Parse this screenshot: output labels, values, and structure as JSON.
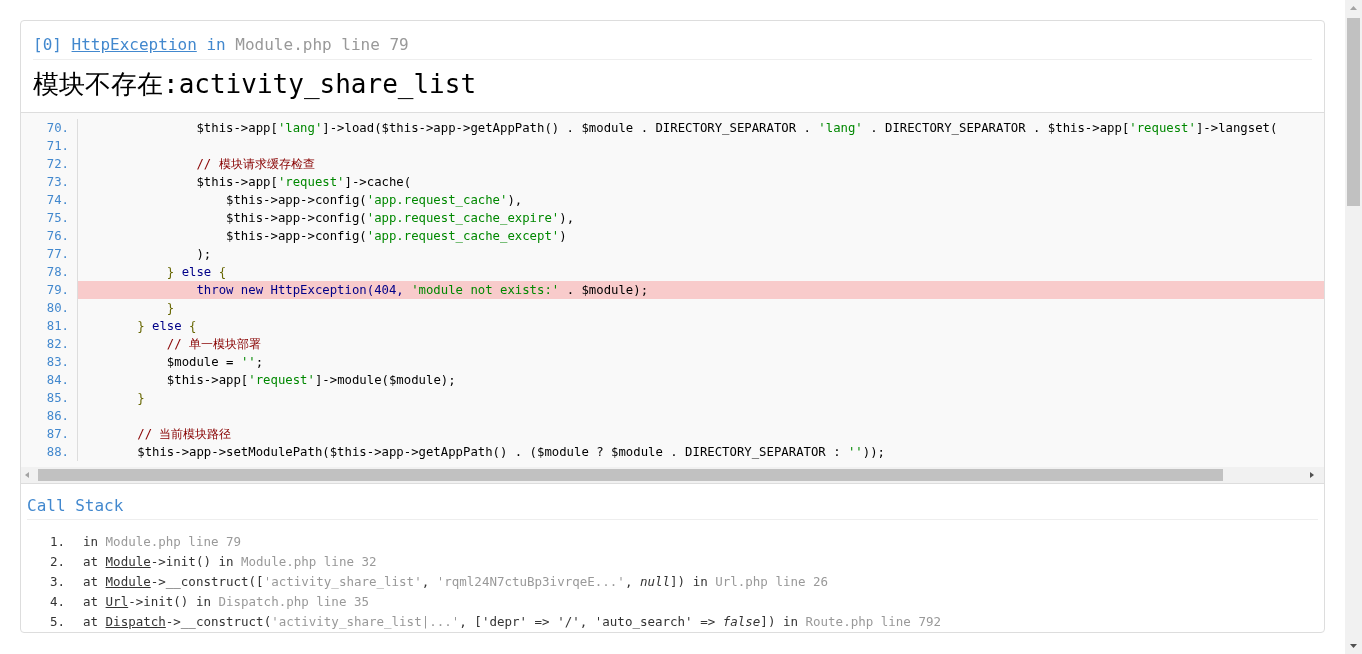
{
  "exception": {
    "index": "[0]",
    "class": "HttpException",
    "in": "in",
    "file": "Module.php line 79"
  },
  "message": "模块不存在:activity_share_list",
  "source": {
    "lines": [
      {
        "number": "70.",
        "highlighted": false,
        "tokens": [
          {
            "kind": "plain",
            "text": "                $this->app["
          },
          {
            "kind": "string",
            "text": "'lang'"
          },
          {
            "kind": "plain",
            "text": "]->load($this->app->getAppPath() . $module . DIRECTORY_SEPARATOR . "
          },
          {
            "kind": "string",
            "text": "'lang'"
          },
          {
            "kind": "plain",
            "text": " . DIRECTORY_SEPARATOR . $this->app["
          },
          {
            "kind": "string",
            "text": "'request'"
          },
          {
            "kind": "plain",
            "text": "]->langset("
          }
        ]
      },
      {
        "number": "71.",
        "highlighted": false
      },
      {
        "number": "72.",
        "highlighted": false,
        "tokens": [
          {
            "kind": "comment",
            "text": "                // 模块请求缓存检查"
          }
        ]
      },
      {
        "number": "73.",
        "highlighted": false,
        "tokens": [
          {
            "kind": "plain",
            "text": "                $this->app["
          },
          {
            "kind": "string",
            "text": "'request'"
          },
          {
            "kind": "plain",
            "text": "]->cache("
          }
        ]
      },
      {
        "number": "74.",
        "highlighted": false,
        "tokens": [
          {
            "kind": "plain",
            "text": "                    $this->app->config("
          },
          {
            "kind": "string",
            "text": "'app.request_cache'"
          },
          {
            "kind": "plain",
            "text": "),"
          }
        ]
      },
      {
        "number": "75.",
        "highlighted": false,
        "tokens": [
          {
            "kind": "plain",
            "text": "                    $this->app->config("
          },
          {
            "kind": "string",
            "text": "'app.request_cache_expire'"
          },
          {
            "kind": "plain",
            "text": "),"
          }
        ]
      },
      {
        "number": "76.",
        "highlighted": false,
        "tokens": [
          {
            "kind": "plain",
            "text": "                    $this->app->config("
          },
          {
            "kind": "string",
            "text": "'app.request_cache_except'"
          },
          {
            "kind": "plain",
            "text": ")"
          }
        ]
      },
      {
        "number": "77.",
        "highlighted": false,
        "tokens": [
          {
            "kind": "plain",
            "text": "                );"
          }
        ]
      },
      {
        "number": "78.",
        "highlighted": false,
        "tokens": [
          {
            "kind": "punct",
            "text": "            }"
          },
          {
            "kind": "keyword",
            "text": " else "
          },
          {
            "kind": "punct",
            "text": "{"
          }
        ]
      },
      {
        "number": "79.",
        "highlighted": true,
        "tokens": [
          {
            "kind": "keyword",
            "text": "                throw new HttpException(404, "
          },
          {
            "kind": "string",
            "text": "'module not exists:'"
          },
          {
            "kind": "plain",
            "text": " . $module);"
          }
        ]
      },
      {
        "number": "80.",
        "highlighted": false,
        "tokens": [
          {
            "kind": "punct",
            "text": "            }"
          }
        ]
      },
      {
        "number": "81.",
        "highlighted": false,
        "tokens": [
          {
            "kind": "punct",
            "text": "        }"
          },
          {
            "kind": "keyword",
            "text": " else "
          },
          {
            "kind": "punct",
            "text": "{"
          }
        ]
      },
      {
        "number": "82.",
        "highlighted": false,
        "tokens": [
          {
            "kind": "comment",
            "text": "            // 单一模块部署"
          }
        ]
      },
      {
        "number": "83.",
        "highlighted": false,
        "tokens": [
          {
            "kind": "plain",
            "text": "            $module = "
          },
          {
            "kind": "string",
            "text": "''"
          },
          {
            "kind": "plain",
            "text": ";"
          }
        ]
      },
      {
        "number": "84.",
        "highlighted": false,
        "tokens": [
          {
            "kind": "plain",
            "text": "            $this->app["
          },
          {
            "kind": "string",
            "text": "'request'"
          },
          {
            "kind": "plain",
            "text": "]->module($module);"
          }
        ]
      },
      {
        "number": "85.",
        "highlighted": false,
        "tokens": [
          {
            "kind": "punct",
            "text": "        }"
          }
        ]
      },
      {
        "number": "86.",
        "highlighted": false
      },
      {
        "number": "87.",
        "highlighted": false,
        "tokens": [
          {
            "kind": "comment",
            "text": "        // 当前模块路径"
          }
        ]
      },
      {
        "number": "88.",
        "highlighted": false,
        "tokens": [
          {
            "kind": "plain",
            "text": "        $this->app->setModulePath($this->app->getAppPath() . ($module ? $module . DIRECTORY_SEPARATOR : "
          },
          {
            "kind": "string",
            "text": "''"
          },
          {
            "kind": "plain",
            "text": "));"
          }
        ]
      }
    ]
  },
  "call_stack": {
    "title": "Call Stack",
    "frames": [
      {
        "number": "1.",
        "parts": [
          {
            "kind": "text",
            "text": "in "
          },
          {
            "kind": "file",
            "text": "Module.php line 79"
          }
        ]
      },
      {
        "number": "2.",
        "parts": [
          {
            "kind": "text",
            "text": "at "
          },
          {
            "kind": "class",
            "text": "Module"
          },
          {
            "kind": "text",
            "text": "->init() in "
          },
          {
            "kind": "file",
            "text": "Module.php line 32"
          }
        ]
      },
      {
        "number": "3.",
        "parts": [
          {
            "kind": "text",
            "text": "at "
          },
          {
            "kind": "class",
            "text": "Module"
          },
          {
            "kind": "text",
            "text": "->__construct(["
          },
          {
            "kind": "arg",
            "text": "'activity_share_list'"
          },
          {
            "kind": "text",
            "text": ", "
          },
          {
            "kind": "arg",
            "text": "'rqml24N7ctuBp3ivrqeE...'"
          },
          {
            "kind": "text",
            "text": ", "
          },
          {
            "kind": "literal",
            "text": "null"
          },
          {
            "kind": "text",
            "text": "]) in "
          },
          {
            "kind": "file",
            "text": "Url.php line 26"
          }
        ]
      },
      {
        "number": "4.",
        "parts": [
          {
            "kind": "text",
            "text": "at "
          },
          {
            "kind": "class",
            "text": "Url"
          },
          {
            "kind": "text",
            "text": "->init() in "
          },
          {
            "kind": "file",
            "text": "Dispatch.php line 35"
          }
        ]
      },
      {
        "number": "5.",
        "parts": [
          {
            "kind": "text",
            "text": "at "
          },
          {
            "kind": "class",
            "text": "Dispatch"
          },
          {
            "kind": "text",
            "text": "->__construct("
          },
          {
            "kind": "arg",
            "text": "'activity_share_list|...'"
          },
          {
            "kind": "text",
            "text": ", ['depr' => '/', 'auto_search' => "
          },
          {
            "kind": "literal",
            "text": "false"
          },
          {
            "kind": "text",
            "text": "]) in "
          },
          {
            "kind": "file",
            "text": "Route.php line 792"
          }
        ]
      }
    ]
  }
}
